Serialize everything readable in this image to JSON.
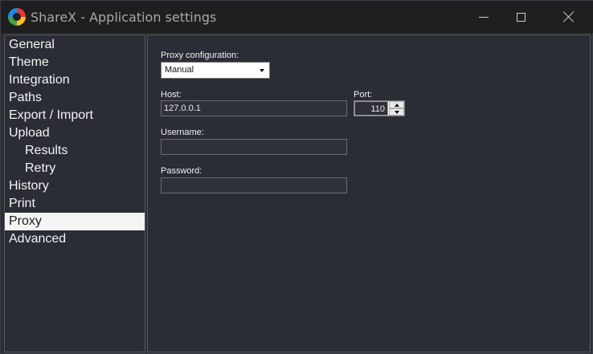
{
  "window": {
    "title": "ShareX - Application settings"
  },
  "sidebar": {
    "items": [
      {
        "label": "General",
        "level": 0
      },
      {
        "label": "Theme",
        "level": 0
      },
      {
        "label": "Integration",
        "level": 0
      },
      {
        "label": "Paths",
        "level": 0
      },
      {
        "label": "Export / Import",
        "level": 0
      },
      {
        "label": "Upload",
        "level": 0
      },
      {
        "label": "Results",
        "level": 1
      },
      {
        "label": "Retry",
        "level": 1
      },
      {
        "label": "History",
        "level": 0
      },
      {
        "label": "Print",
        "level": 0
      },
      {
        "label": "Proxy",
        "level": 0,
        "selected": true
      },
      {
        "label": "Advanced",
        "level": 0
      }
    ]
  },
  "proxy": {
    "config_label": "Proxy configuration:",
    "config_value": "Manual",
    "host_label": "Host:",
    "host_value": "127.0.0.1",
    "port_label": "Port:",
    "port_value": "110",
    "username_label": "Username:",
    "username_value": "",
    "password_label": "Password:",
    "password_value": ""
  },
  "colors": {
    "background": "#2a2d35",
    "titlebar": "#1f1f1f",
    "selected_bg": "#f4f4f4"
  }
}
